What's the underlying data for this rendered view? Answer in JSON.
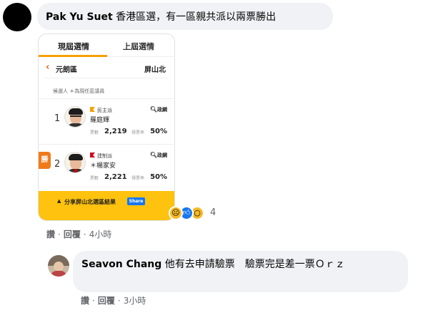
{
  "main_comment": {
    "author": "Pak Yu Suet",
    "text": "香港區選，有一區親共派以兩票勝出",
    "reaction_count": "4",
    "reactions": [
      "sad-reaction-icon",
      "like-reaction-icon",
      "wow-reaction-icon"
    ],
    "actions": {
      "like": "讚",
      "reply": "回覆",
      "time": "4小時"
    }
  },
  "card": {
    "tabs": [
      "現屆選情",
      "上屆選情"
    ],
    "district": "元朗區",
    "constituency": "屏山北",
    "note": "候選人 ＊為現任區議員",
    "win_label": "勝",
    "vote_label": "票數",
    "turnout_label": "得票率",
    "platform_label": "政綱",
    "candidates": [
      {
        "rank": "1",
        "camp": "民主派",
        "name": "羅庭輝",
        "votes": "2,219",
        "pct": "50%",
        "camp_color": "#f5a000"
      },
      {
        "rank": "2",
        "camp": "建制派",
        "name": "＊楊家安",
        "votes": "2,221",
        "pct": "50%",
        "camp_color": "#d0021b"
      }
    ],
    "share_text": "分享屏山北選區結果",
    "share_button": "Share",
    "accent_color": "#ffc20e"
  },
  "reply": {
    "author": "Seavon Chang",
    "text": "他有去申請驗票　驗票完是差一票Ｏｒｚ",
    "actions": {
      "like": "讚",
      "reply": "回覆",
      "time": "3小時"
    }
  }
}
